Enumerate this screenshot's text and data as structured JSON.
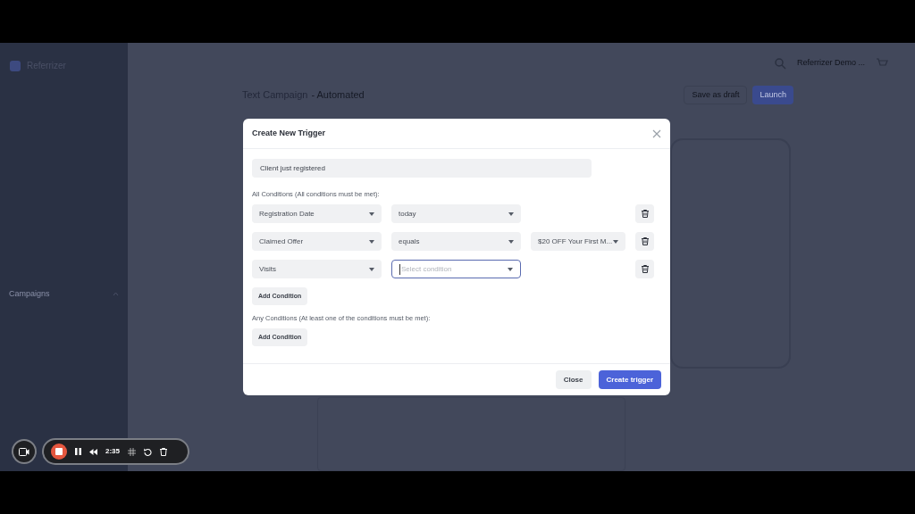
{
  "app": {
    "brand": "Referrizer",
    "nav": [
      {
        "label": "Campaigns",
        "expanded": true
      }
    ],
    "header": {
      "user": "Referrizer Demo ..."
    },
    "page": {
      "title": "Text Campaign",
      "subtitle": "- Automated",
      "buttons": [
        {
          "label": "Save as draft",
          "kind": "outline"
        },
        {
          "label": "Launch",
          "kind": "primary"
        }
      ]
    }
  },
  "modal": {
    "title": "Create New Trigger",
    "name_value": "Client just registered",
    "all_label": "All Conditions (All conditions must be met):",
    "all_conditions": [
      {
        "field": "Registration Date",
        "operator": "today",
        "focused": false
      },
      {
        "field": "Claimed Offer",
        "operator": "equals",
        "value": "$20 OFF Your First M...",
        "focused": false
      },
      {
        "field": "Visits",
        "operator_placeholder": "Select condition",
        "focused": true
      }
    ],
    "add_label": "Add Condition",
    "any_label": "Any Conditions (At least one of the conditions must be met):",
    "any_add_label": "Add Condition",
    "close": "Close",
    "submit": "Create trigger"
  },
  "recorder": {
    "time": "2:35"
  }
}
